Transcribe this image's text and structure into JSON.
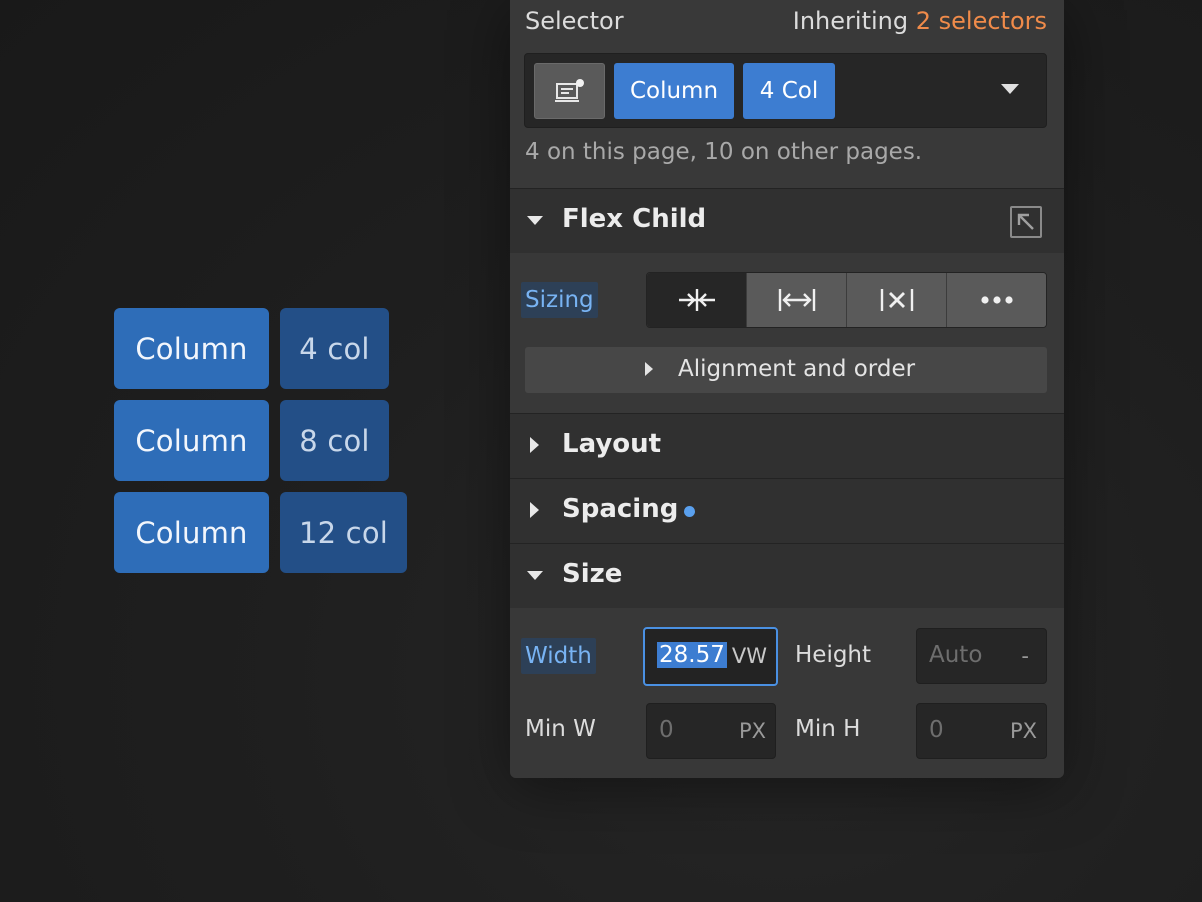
{
  "preview": {
    "rows": [
      {
        "column": "Column",
        "span": "4 col"
      },
      {
        "column": "Column",
        "span": "8 col"
      },
      {
        "column": "Column",
        "span": "12 col"
      }
    ]
  },
  "selector": {
    "title": "Selector",
    "inheriting_prefix": "Inheriting",
    "inheriting_link": "2 selectors",
    "chips": [
      "Column",
      "4 Col"
    ],
    "chip_icon": "element-icon",
    "count_text": "4 on this page, 10 on other pages."
  },
  "flex_child": {
    "title": "Flex Child",
    "expanded": true,
    "sizing_label": "Sizing",
    "sizing_options": [
      "shrink-icon",
      "grow-icon",
      "none-icon",
      "more-icon"
    ],
    "selected_sizing": "shrink-icon",
    "alignment_label": "Alignment and order"
  },
  "layout": {
    "title": "Layout",
    "expanded": false
  },
  "spacing": {
    "title": "Spacing",
    "expanded": false,
    "modified": true
  },
  "size": {
    "title": "Size",
    "expanded": true,
    "width_label": "Width",
    "width_value": "28.57",
    "width_unit": "VW",
    "height_label": "Height",
    "height_placeholder": "Auto",
    "height_unit": "-",
    "min_w_label": "Min W",
    "min_w_placeholder": "0",
    "min_w_unit": "PX",
    "min_h_label": "Min H",
    "min_h_placeholder": "0",
    "min_h_unit": "PX"
  },
  "colors": {
    "accent_blue": "#3d7dd1",
    "inherit_orange": "#f08b4a",
    "label_blue": "#78b3f3",
    "modified_dot": "#5aa0ee"
  }
}
